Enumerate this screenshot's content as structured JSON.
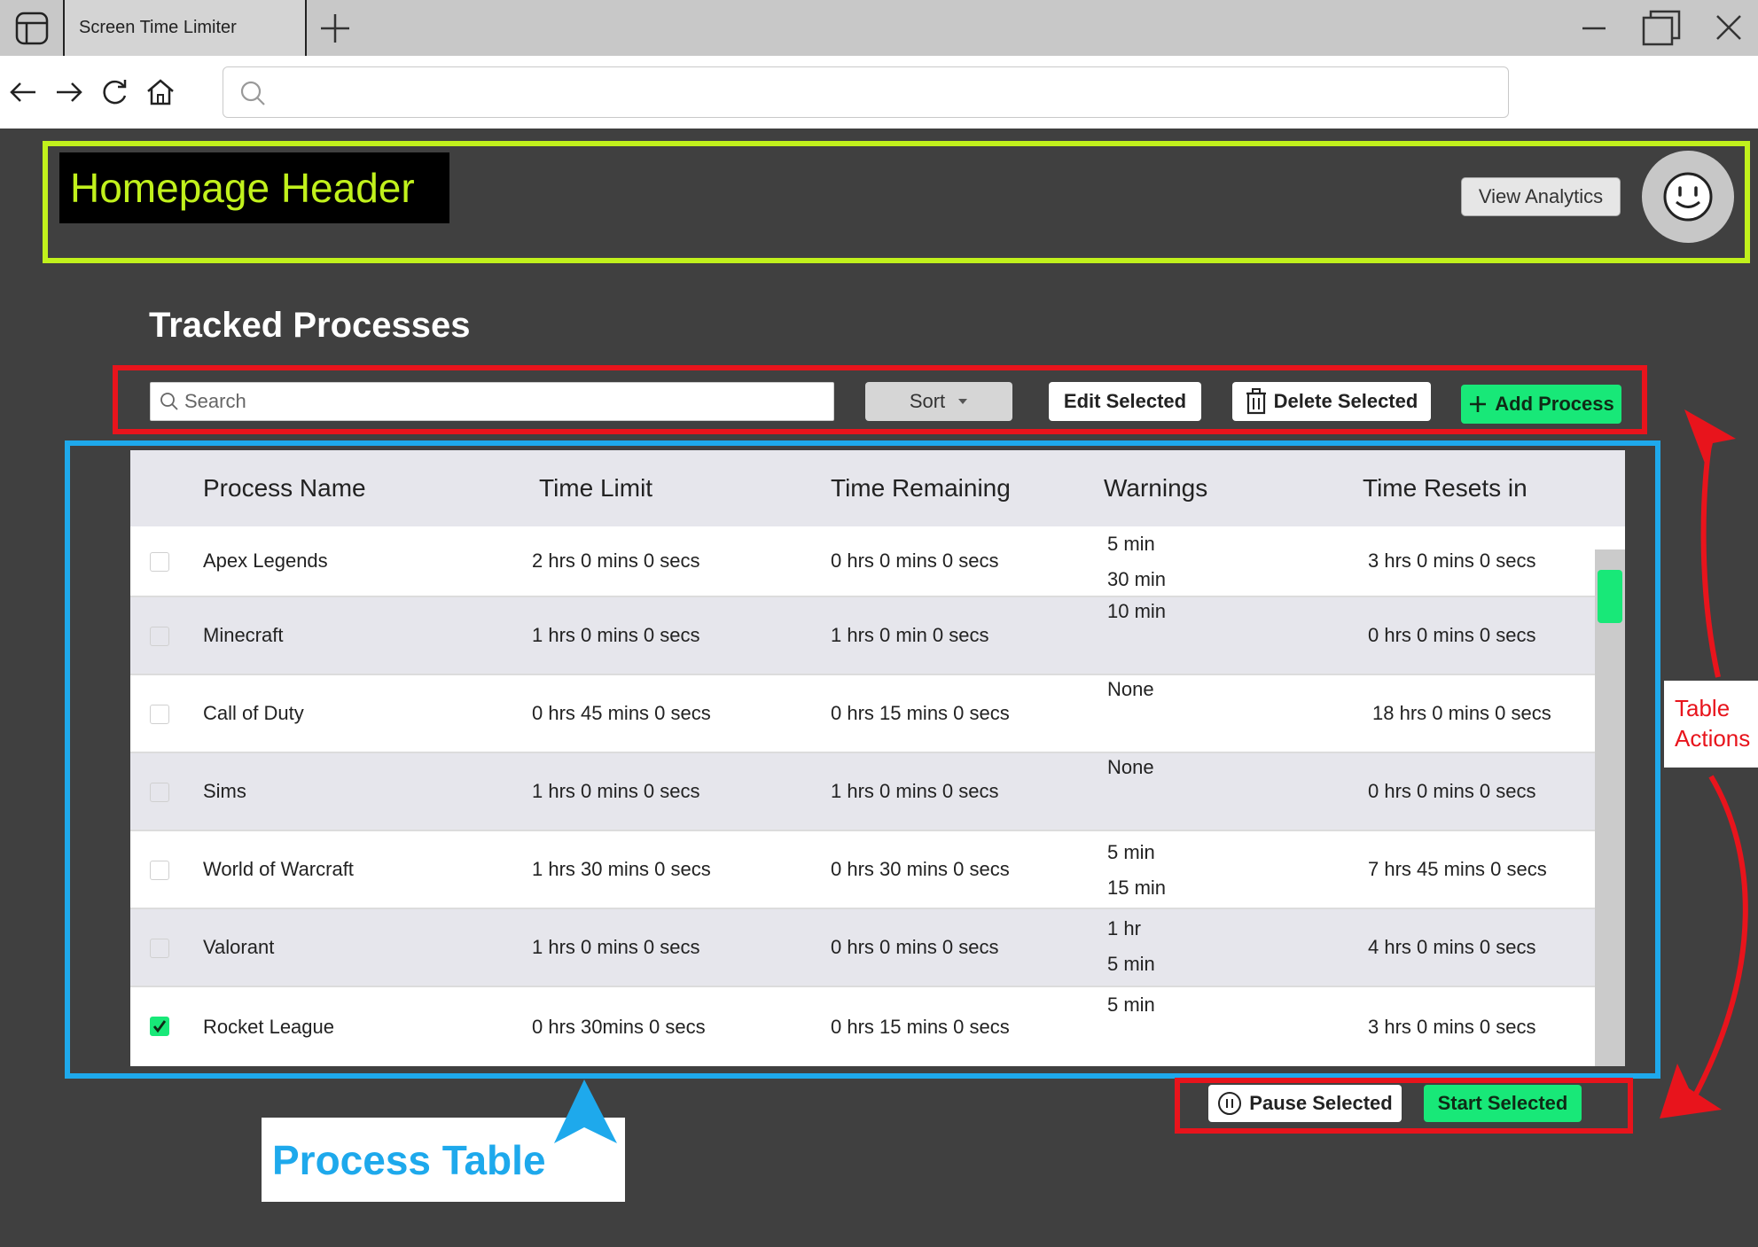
{
  "browser": {
    "tab_title": "Screen Time Limiter",
    "url": ""
  },
  "header": {
    "annotation_label": "Homepage Header",
    "view_analytics_label": "View Analytics"
  },
  "page": {
    "title": "Tracked Processes"
  },
  "toolbar": {
    "search_placeholder": "Search",
    "sort_label": "Sort",
    "edit_label": "Edit Selected",
    "delete_label": "Delete Selected",
    "add_label": "Add Process"
  },
  "table": {
    "columns": [
      "Process Name",
      "Time Limit",
      "Time Remaining",
      "Warnings",
      "Time Resets in"
    ],
    "rows": [
      {
        "checked": false,
        "name": "Apex Legends",
        "limit": "2 hrs 0 mins 0 secs",
        "remaining": "0 hrs 0 mins 0 secs",
        "warnings": [
          "5 min",
          "30 min"
        ],
        "resets": "3 hrs 0 mins 0 secs"
      },
      {
        "checked": false,
        "name": "Minecraft",
        "limit": "1 hrs 0 mins 0 secs",
        "remaining": "1 hrs 0 min 0 secs",
        "warnings": [
          "10 min"
        ],
        "resets": "0 hrs 0 mins 0 secs"
      },
      {
        "checked": false,
        "name": "Call of Duty",
        "limit": "0 hrs 45 mins 0 secs",
        "remaining": "0 hrs 15 mins 0 secs",
        "warnings": [
          "None"
        ],
        "resets": "18 hrs 0 mins 0 secs"
      },
      {
        "checked": false,
        "name": "Sims",
        "limit": "1 hrs 0 mins 0 secs",
        "remaining": "1 hrs 0 mins 0 secs",
        "warnings": [
          "None"
        ],
        "resets": "0 hrs 0 mins 0 secs"
      },
      {
        "checked": false,
        "name": "World of Warcraft",
        "limit": "1 hrs 30 mins 0 secs",
        "remaining": "0 hrs 30 mins 0 secs",
        "warnings": [
          "5 min",
          "15 min"
        ],
        "resets": "7 hrs 45 mins 0 secs"
      },
      {
        "checked": false,
        "name": "Valorant",
        "limit": "1 hrs 0 mins 0 secs",
        "remaining": "0 hrs 0 mins 0 secs",
        "warnings": [
          "1 hr",
          "5 min"
        ],
        "resets": "4 hrs 0 mins 0 secs"
      },
      {
        "checked": true,
        "name": "Rocket League",
        "limit": "0 hrs 30mins 0 secs",
        "remaining": "0 hrs 15 mins 0 secs",
        "warnings": [
          "5 min"
        ],
        "resets": "3 hrs 0 mins 0 secs"
      }
    ]
  },
  "bottom_actions": {
    "pause_label": "Pause Selected",
    "start_label": "Start Selected"
  },
  "annotations": {
    "process_table": "Process Table",
    "table_actions": "Table\nActions"
  },
  "colors": {
    "header_accent": "#c1f11c",
    "table_accent": "#1ea9ec",
    "actions_accent": "#e8141c",
    "primary_green": "#18e878",
    "background": "#404040"
  },
  "icons": [
    "sidebar-toggle-icon",
    "plus-icon",
    "minimize-icon",
    "restore-icon",
    "close-icon",
    "back-icon",
    "forward-icon",
    "refresh-icon",
    "home-icon",
    "search-icon",
    "smiley-avatar-icon",
    "chevron-down-icon",
    "trash-icon",
    "pause-icon"
  ]
}
